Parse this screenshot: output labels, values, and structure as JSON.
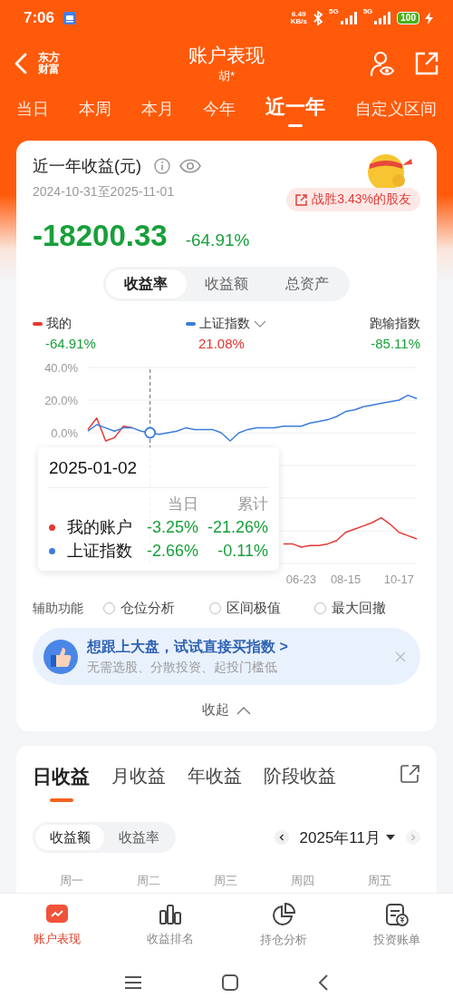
{
  "status_bar": {
    "time": "7:06",
    "net_speed": [
      "6.49",
      "KB/s"
    ],
    "network_labels": [
      "5G",
      "5G"
    ],
    "battery": "100"
  },
  "header": {
    "logo": [
      "东方",
      "财富"
    ],
    "title": "账户表现",
    "subtitle": "胡*"
  },
  "period_tabs": [
    {
      "label": "当日",
      "selected": false
    },
    {
      "label": "本周",
      "selected": false
    },
    {
      "label": "本月",
      "selected": false
    },
    {
      "label": "今年",
      "selected": false
    },
    {
      "label": "近一年",
      "selected": true
    },
    {
      "label": "自定义区间",
      "selected": false
    }
  ],
  "summary": {
    "title": "近一年收益(元)",
    "date_range": "2024-10-31至2025-11-01",
    "badge": "战胜3.43%的股友",
    "amount": "-18200.33",
    "rate": "-64.91%",
    "view_tabs": [
      {
        "label": "收益率",
        "selected": true
      },
      {
        "label": "收益额",
        "selected": false
      },
      {
        "label": "总资产",
        "selected": false
      }
    ],
    "legend": [
      {
        "label": "我的",
        "value": {
          "text": "-64.91%",
          "color": "#17a03a"
        },
        "color": "#e53935",
        "dropdown": false
      },
      {
        "label": "上证指数",
        "value": {
          "text": "21.08%",
          "color": "#e5322d"
        },
        "color": "#3b7ddd",
        "dropdown": true
      },
      {
        "label": "跑输指数",
        "value": {
          "text": "-85.11%",
          "color": "#17a03a"
        },
        "dropdown": false
      }
    ],
    "chart_data": {
      "type": "line",
      "categories": [
        null,
        null,
        null,
        null,
        null,
        null,
        null,
        null,
        null,
        null,
        null,
        null,
        null,
        null,
        null,
        null,
        null,
        null,
        null,
        null,
        null,
        null,
        null,
        null,
        "06-23",
        null,
        null,
        null,
        null,
        "08-15",
        null,
        null,
        null,
        null,
        null,
        "10-17",
        null,
        null
      ],
      "series": [
        {
          "color": "#e53935",
          "values": [
            2,
            9,
            -5,
            -3,
            4,
            3,
            null,
            null,
            null,
            null,
            null,
            null,
            null,
            null,
            null,
            null,
            null,
            null,
            null,
            null,
            null,
            null,
            -68,
            -68,
            -70,
            -69,
            -69,
            -68,
            -66,
            -61,
            -59,
            -57,
            -55,
            -52,
            -56,
            -61,
            -63,
            -65
          ]
        },
        {
          "color": "#3b7ddd",
          "values": [
            1,
            5,
            3,
            1,
            3,
            3,
            1,
            0,
            -1,
            0,
            1,
            3,
            2,
            2,
            2,
            0,
            -5,
            0,
            2,
            3,
            3,
            3,
            4,
            4,
            4,
            6,
            7,
            8,
            10,
            13,
            14,
            16,
            17,
            18,
            19,
            20,
            23,
            21
          ]
        }
      ],
      "ylim": [
        -80,
        40
      ],
      "yticks": [
        {
          "value": 40,
          "label": "40.0%"
        },
        {
          "value": 20,
          "label": "20.0%"
        },
        {
          "value": 0,
          "label": "0.0%"
        }
      ]
    },
    "tooltip": {
      "date": "2025-01-02",
      "columns": [
        "当日",
        "累计"
      ],
      "rows": [
        {
          "label": "我的账户",
          "color": "#e53935",
          "day": "-3.25%",
          "total": "-21.26%"
        },
        {
          "label": "上证指数",
          "color": "#3b7ddd",
          "day": "-2.66%",
          "total": "-0.11%"
        }
      ]
    },
    "assist": {
      "label": "辅助功能",
      "options": [
        {
          "label": "仓位分析",
          "checked": false
        },
        {
          "label": "区间极值",
          "checked": false
        },
        {
          "label": "最大回撤",
          "checked": false
        }
      ]
    },
    "promo": {
      "title": "想跟上大盘，试试直接买指数 >",
      "subtitle": "无需选股、分散投资、起投门槛低"
    },
    "collapse": "收起"
  },
  "earnings": {
    "tabs": [
      {
        "label": "日收益",
        "selected": true
      },
      {
        "label": "月收益",
        "selected": false
      },
      {
        "label": "年收益",
        "selected": false
      },
      {
        "label": "阶段收益",
        "selected": false
      }
    ],
    "modes": [
      {
        "label": "收益额",
        "selected": true
      },
      {
        "label": "收益率",
        "selected": false
      }
    ],
    "month": "2025年11月",
    "weekdays": [
      "周一",
      "周二",
      "周三",
      "周四",
      "周五"
    ]
  },
  "bottom_nav": [
    {
      "label": "账户表现",
      "selected": true
    },
    {
      "label": "收益排名",
      "selected": false
    },
    {
      "label": "持仓分析",
      "selected": false
    },
    {
      "label": "投资账单",
      "selected": false
    }
  ]
}
